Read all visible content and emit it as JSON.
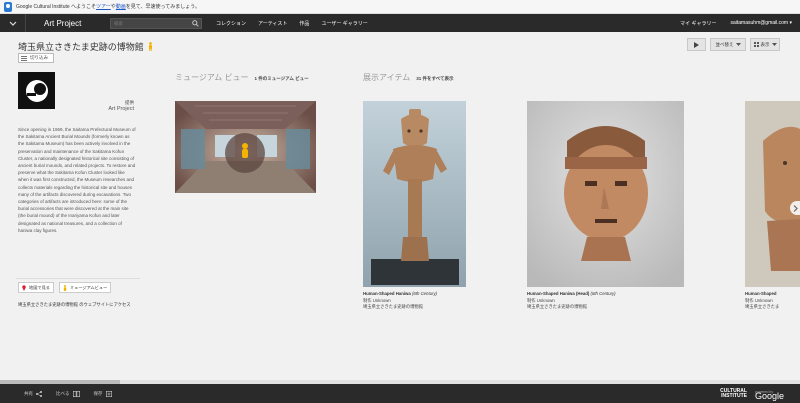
{
  "notification": {
    "text_before": "Google Cultural Institute へようこそ",
    "link_tour": "ツアー",
    "text_mid": "や",
    "link_video": "動画",
    "text_after": "を見て、早速使ってみましょう。"
  },
  "topnav": {
    "site_title": "Art Project",
    "search_placeholder": "検索",
    "links": [
      "コレクション",
      "アーティスト",
      "作品",
      "ユーザー ギャラリー"
    ],
    "my_gallery": "マイ ギャラリー",
    "account_email": "saitamasuhm@gmail.com ▾"
  },
  "page": {
    "title": "埼玉県立さきたま史跡の博物館",
    "collapse_label": "切り込み",
    "controls": {
      "sort_label": "並べ替え",
      "view_label": "表示"
    }
  },
  "museum": {
    "meta_label": "提供",
    "meta_value": "Art Project",
    "description": "Since opening in 1969, the Saitama Prefectural Museum of the Sakitama Ancient Burial Mounds (formerly known as the Sakitama Museum) has been actively involved in the preservation and maintenance of the Sakitama Kofun Cluster, a nationally designated historical site consisting of ancient burial mounds, and related projects. To restore and preserve what the Sakitama Kofun Cluster looked like when it was first constructed, the Museum researches and collects materials regarding the historical site and houses many of the artifacts discovered during excavations. Two categories of artifacts are introduced here: some of the burial accessories that were discovered at the main site (the burial mound) of the Inariyama Kofun and later designated as national treasures, and a collection of haniwa clay figures.",
    "map_button": "地図で見る",
    "museum_view_button": "ミュージアムビュー",
    "website_link": "埼玉県立さきたま史跡の博物館 のウェブサイトにアクセス"
  },
  "sections": {
    "museum_view": {
      "heading": "ミュージアム ビュー",
      "count": "1 件のミュージアム ビュー"
    },
    "exhibits": {
      "heading": "展示アイテム",
      "count": "31 件をすべて表示"
    }
  },
  "items": [
    {
      "title": "Human-Shaped Haniwa",
      "century": "(6th Century)",
      "creator_label": "制作",
      "creator": "Unknown",
      "museum": "埼玉県立さきたま史跡の博物館"
    },
    {
      "title": "Human-Shaped Haniwa (Head)",
      "century": "(6th Century)",
      "creator_label": "制作",
      "creator": "Unknown",
      "museum": "埼玉県立さきたま史跡の博物館"
    },
    {
      "title": "Human-Shaped",
      "century": "",
      "creator_label": "制作",
      "creator": "Unknown",
      "museum": "埼玉県立さきたま"
    }
  ],
  "footer": {
    "share": "共有",
    "compare": "比べる",
    "save": "保存",
    "brand_line1": "CULTURAL",
    "brand_line2": "INSTITUTE",
    "powered_by": "powered by",
    "google": "Google"
  },
  "colors": {
    "nav_bg": "#2a2a2a",
    "page_bg": "#f1f1f1",
    "link": "#1a56c8",
    "pegman": "#f2b400"
  }
}
